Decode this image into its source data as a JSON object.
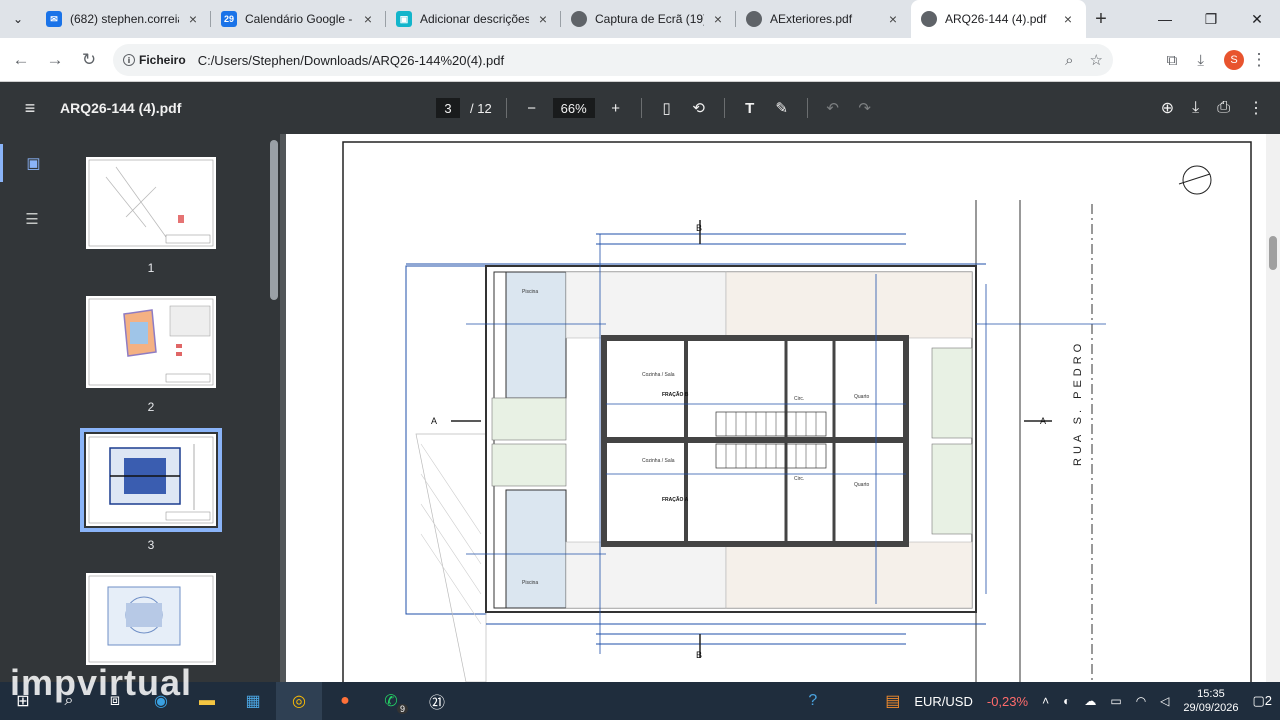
{
  "tabs": [
    {
      "title": "(682) stephen.correia",
      "favicon": "mail-icon",
      "color": "#1a73e8",
      "glyph": "✉"
    },
    {
      "title": "Calendário Google - S",
      "favicon": "calendar-icon",
      "color": "#1a73e8",
      "glyph": "29"
    },
    {
      "title": "Adicionar descrições",
      "favicon": "doc-icon",
      "color": "#12b5cb",
      "glyph": "▣"
    },
    {
      "title": "Captura de Ecrã (19).p",
      "favicon": "globe-icon",
      "color": "#5f6368",
      "glyph": "◍"
    },
    {
      "title": "AExteriores.pdf",
      "favicon": "globe-icon",
      "color": "#5f6368",
      "glyph": "◍"
    },
    {
      "title": "ARQ26-144 (4).pdf",
      "favicon": "globe-icon",
      "color": "#5f6368",
      "glyph": "◍",
      "active": true
    }
  ],
  "address": {
    "scheme_label": "Ficheiro",
    "url": "C:/Users/Stephen/Downloads/ARQ26-144%20(4).pdf"
  },
  "profile_initial": "S",
  "pdf": {
    "filename": "ARQ26-144 (4).pdf",
    "current_page": "3",
    "total_pages": "/ 12",
    "zoom": "66%"
  },
  "thumbnails": [
    {
      "label": "1"
    },
    {
      "label": "2"
    },
    {
      "label": "3",
      "selected": true
    },
    {
      "label": "4"
    }
  ],
  "drawing": {
    "street": "RUA S. PEDRO",
    "section_a": "A",
    "section_b": "B",
    "pool_label": "Piscina",
    "kitchen_label": "Cozinha / Sala",
    "bedroom_label": "Quarto",
    "wc_label": "Circ.",
    "fraction_b": "FRAÇÃO B",
    "fraction_a": "FRAÇÃO A"
  },
  "taskbar": {
    "currency_pair": "EUR/USD",
    "currency_change": "-0,23%",
    "time": "15:35",
    "date": "29/09/2026",
    "whatsapp_badge": "9",
    "notifications": "2"
  },
  "watermark": "impvirtual"
}
